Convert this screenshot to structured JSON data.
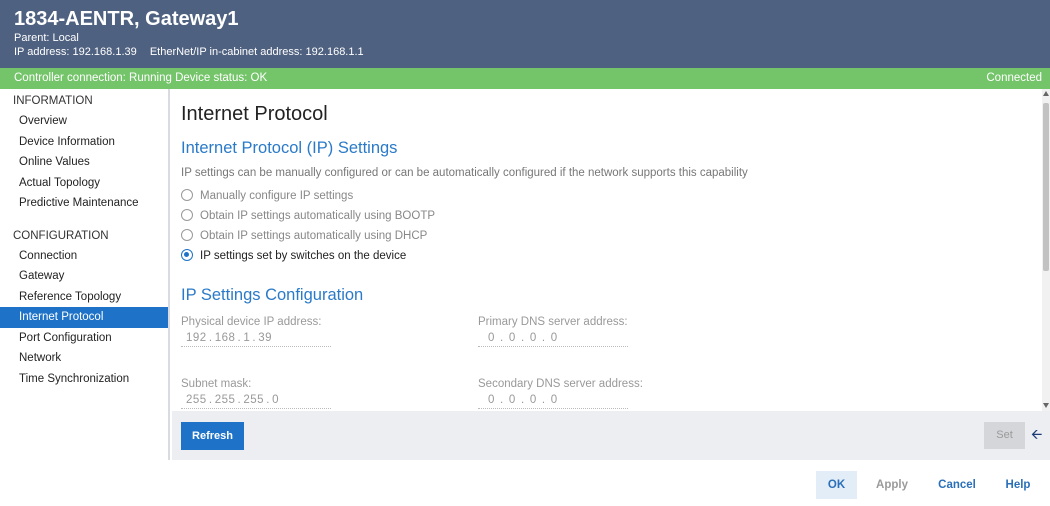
{
  "header": {
    "title": "1834-AENTR, Gateway1",
    "parent_label": "Parent:",
    "parent_value": "Local",
    "ip_label": "IP address:",
    "ip_value": "192.168.1.39",
    "cabinet_label": "EtherNet/IP in-cabinet address:",
    "cabinet_value": "192.168.1.1"
  },
  "status": {
    "controller_connection": "Controller connection: Running",
    "device_status": "Device status: OK",
    "connected": "Connected",
    "color": "#74c46a"
  },
  "sidebar": {
    "information_heading": "INFORMATION",
    "information_items": [
      {
        "label": "Overview"
      },
      {
        "label": "Device Information"
      },
      {
        "label": "Online Values"
      },
      {
        "label": "Actual Topology"
      },
      {
        "label": "Predictive Maintenance"
      }
    ],
    "configuration_heading": "CONFIGURATION",
    "configuration_items": [
      {
        "label": "Connection"
      },
      {
        "label": "Gateway"
      },
      {
        "label": "Reference Topology"
      },
      {
        "label": "Internet Protocol",
        "active": true
      },
      {
        "label": "Port Configuration"
      },
      {
        "label": "Network"
      },
      {
        "label": "Time Synchronization"
      }
    ],
    "active_color": "#1e73c8"
  },
  "main": {
    "page_title": "Internet Protocol",
    "ip_settings_heading": "Internet Protocol (IP) Settings",
    "description": "IP settings can be manually configured or can be automatically configured if the network supports this capability",
    "radio_options": [
      {
        "label": "Manually configure IP settings",
        "selected": false
      },
      {
        "label": "Obtain IP settings automatically using BOOTP",
        "selected": false
      },
      {
        "label": "Obtain IP settings automatically using DHCP",
        "selected": false
      },
      {
        "label": "IP settings set by switches on the device",
        "selected": true
      }
    ],
    "config_heading": "IP Settings Configuration",
    "fields": {
      "physical_ip": {
        "label": "Physical device IP address:",
        "octets": [
          "192",
          "168",
          "1",
          "39"
        ]
      },
      "primary_dns": {
        "label": "Primary DNS server address:",
        "octets": [
          "0",
          "0",
          "0",
          "0"
        ]
      },
      "subnet_mask": {
        "label": "Subnet mask:",
        "octets": [
          "255",
          "255",
          "255",
          "0"
        ]
      },
      "secondary_dns": {
        "label": "Secondary DNS server address:",
        "octets": [
          "0",
          "0",
          "0",
          "0"
        ]
      }
    },
    "heading_color": "#2a7ac9"
  },
  "footer": {
    "refresh_label": "Refresh",
    "set_label": "Set",
    "back_icon": "left-arrow-icon"
  },
  "dialog": {
    "ok_label": "OK",
    "apply_label": "Apply",
    "cancel_label": "Cancel",
    "help_label": "Help"
  }
}
